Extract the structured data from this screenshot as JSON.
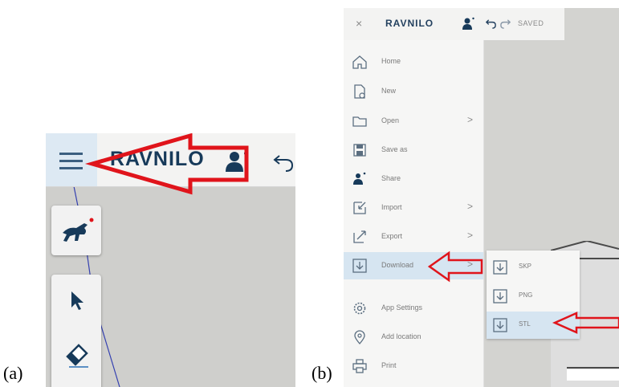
{
  "labels": {
    "a": "(a)",
    "b": "(b)"
  },
  "panel_a": {
    "title": "RAVNILO",
    "icons": [
      "menu-icon",
      "user-icon",
      "undo-icon",
      "dog-logo-icon",
      "cursor-icon",
      "eraser-icon"
    ]
  },
  "panel_b": {
    "header": {
      "close": "×",
      "title": "RAVNILO",
      "status": "SAVED"
    },
    "menu": [
      {
        "label": "Home",
        "icon": "home-icon",
        "submenu": false
      },
      {
        "label": "New",
        "icon": "new-file-icon",
        "submenu": false
      },
      {
        "label": "Open",
        "icon": "folder-icon",
        "submenu": true
      },
      {
        "label": "Save as",
        "icon": "save-icon",
        "submenu": false
      },
      {
        "label": "Share",
        "icon": "share-icon",
        "submenu": false
      },
      {
        "label": "Import",
        "icon": "import-icon",
        "submenu": true
      },
      {
        "label": "Export",
        "icon": "export-icon",
        "submenu": true
      },
      {
        "label": "Download",
        "icon": "download-icon",
        "submenu": true,
        "active": true
      },
      {
        "label": "App Settings",
        "icon": "settings-icon",
        "submenu": false
      },
      {
        "label": "Add location",
        "icon": "location-icon",
        "submenu": false
      },
      {
        "label": "Print",
        "icon": "print-icon",
        "submenu": false
      }
    ],
    "download_submenu": [
      {
        "label": "SKP",
        "icon": "download-icon"
      },
      {
        "label": "PNG",
        "icon": "download-icon"
      },
      {
        "label": "STL",
        "icon": "download-icon",
        "active": true
      }
    ],
    "chevron": ">"
  },
  "colors": {
    "accent": "#173a5a",
    "highlight": "#d6e5f1",
    "arrow": "#e0141b",
    "canvas": "#d0d0cd"
  }
}
